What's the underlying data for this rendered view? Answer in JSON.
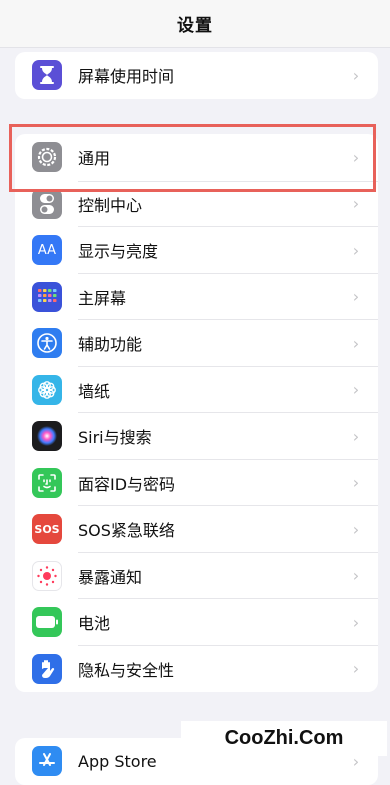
{
  "header": {
    "title": "设置"
  },
  "screen_time": {
    "label": "屏幕使用时间",
    "icon": "hourglass-icon",
    "color": "#5b4fd6"
  },
  "settings_items": [
    {
      "key": "general",
      "label": "通用",
      "icon": "gear-icon",
      "color": "#8e8e93"
    },
    {
      "key": "control-center",
      "label": "控制中心",
      "icon": "toggles-icon",
      "color": "#8e8e93"
    },
    {
      "key": "display",
      "label": "显示与亮度",
      "icon": "display-aa-icon",
      "color": "#3478f6"
    },
    {
      "key": "home-screen",
      "label": "主屏幕",
      "icon": "home-grid-icon",
      "color": "#3a52d9"
    },
    {
      "key": "accessibility",
      "label": "辅助功能",
      "icon": "accessibility-icon",
      "color": "#2f7df0"
    },
    {
      "key": "wallpaper",
      "label": "墙纸",
      "icon": "flower-icon",
      "color": "#35b5e8"
    },
    {
      "key": "siri",
      "label": "Siri与搜索",
      "icon": "siri-icon",
      "color": "#1c1c1e"
    },
    {
      "key": "face-id",
      "label": "面容ID与密码",
      "icon": "face-id-icon",
      "color": "#34c759"
    },
    {
      "key": "sos",
      "label": "SOS紧急联络",
      "icon": "sos-icon",
      "color": "#e5483d",
      "icon_text": "SOS"
    },
    {
      "key": "exposure",
      "label": "暴露通知",
      "icon": "exposure-icon",
      "color": "#ffffff"
    },
    {
      "key": "battery",
      "label": "电池",
      "icon": "battery-icon",
      "color": "#34c759"
    },
    {
      "key": "privacy",
      "label": "隐私与安全性",
      "icon": "hand-icon",
      "color": "#2f6fe8"
    }
  ],
  "app_store": {
    "label": "App Store",
    "icon": "app-store-icon",
    "color": "#2f8cf2"
  },
  "watermark": {
    "text": "CooZhi.Com"
  },
  "highlight_color": "#e8615a"
}
